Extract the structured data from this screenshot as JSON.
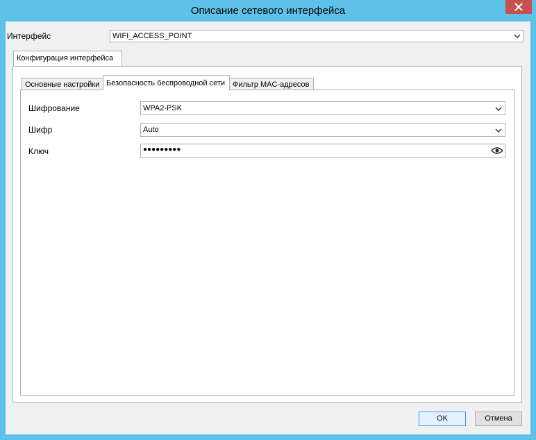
{
  "window": {
    "title": "Описание сетевого интерфейса"
  },
  "interface": {
    "label": "Интерфейс",
    "value": "WIFI_ACCESS_POINT"
  },
  "outer_tabs": [
    {
      "label": "Конфигурация интерфейса"
    }
  ],
  "inner_tabs": [
    {
      "label": "Основные настройки"
    },
    {
      "label": "Безопасность беспроводной сети"
    },
    {
      "label": "Фильтр MAC-адресов"
    }
  ],
  "security": {
    "encryption": {
      "label": "Шифрование",
      "value": "WPA2-PSK"
    },
    "cipher": {
      "label": "Шифр",
      "value": "Auto"
    },
    "key": {
      "label": "Ключ",
      "value": "●●●●●●●●●"
    }
  },
  "buttons": {
    "ok": "OK",
    "cancel": "Отмена"
  },
  "icons": {
    "close": "close-icon",
    "dropdown": "chevron-down-icon",
    "reveal": "eye-icon"
  }
}
